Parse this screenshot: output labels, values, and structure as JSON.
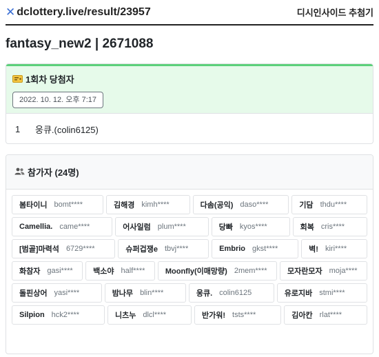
{
  "header": {
    "logo_glyph": "✕",
    "site_url": "dclottery.live/result/23957",
    "nav_label": "디시인사이드 추첨기"
  },
  "page": {
    "title": "fantasy_new2 | 2671088"
  },
  "winners": {
    "icon": "ticket-icon",
    "title": "1회차 당첨자",
    "date": "2022. 10. 12. 오후 7:17",
    "items": [
      {
        "rank": "1",
        "name": "웅큐.(colin6125)"
      }
    ]
  },
  "participants": {
    "icon": "people-icon",
    "title": "참가자 (24명)",
    "items": [
      {
        "nick": "봄타이니",
        "id": "bomt****"
      },
      {
        "nick": "김해경",
        "id": "kimh****"
      },
      {
        "nick": "다솜(공익)",
        "id": "daso****"
      },
      {
        "nick": "기담",
        "id": "thdu****"
      },
      {
        "nick": "Camellia.",
        "id": "came****"
      },
      {
        "nick": "어사일럼",
        "id": "plum****"
      },
      {
        "nick": "당빠",
        "id": "kyos****"
      },
      {
        "nick": "회복",
        "id": "cris****"
      },
      {
        "nick": "[범골]마력석",
        "id": "6729****"
      },
      {
        "nick": "슈퍼겁쟁e",
        "id": "tbvj****"
      },
      {
        "nick": "Embrio",
        "id": "gkst****"
      },
      {
        "nick": "벽!",
        "id": "kiri****"
      },
      {
        "nick": "화참자",
        "id": "gasi****"
      },
      {
        "nick": "백소야",
        "id": "half****"
      },
      {
        "nick": "Moonfly(이매망량)",
        "id": "2mem****"
      },
      {
        "nick": "모자란모자",
        "id": "moja****"
      },
      {
        "nick": "돌핀상어",
        "id": "yasi****"
      },
      {
        "nick": "밤나무",
        "id": "blin****"
      },
      {
        "nick": "웅큐.",
        "id": "colin6125"
      },
      {
        "nick": "유로지바",
        "id": "stmi****"
      },
      {
        "nick": "Silpion",
        "id": "hck2****"
      },
      {
        "nick": "니츠누",
        "id": "dlcl****"
      },
      {
        "nick": "반가워!",
        "id": "tsts****"
      },
      {
        "nick": "김아칸",
        "id": "rlat****"
      }
    ]
  },
  "colors": {
    "winner_header_bg": "#e6faea",
    "winner_header_border": "#5cd07a",
    "logo_accent": "#3b6fd4"
  }
}
